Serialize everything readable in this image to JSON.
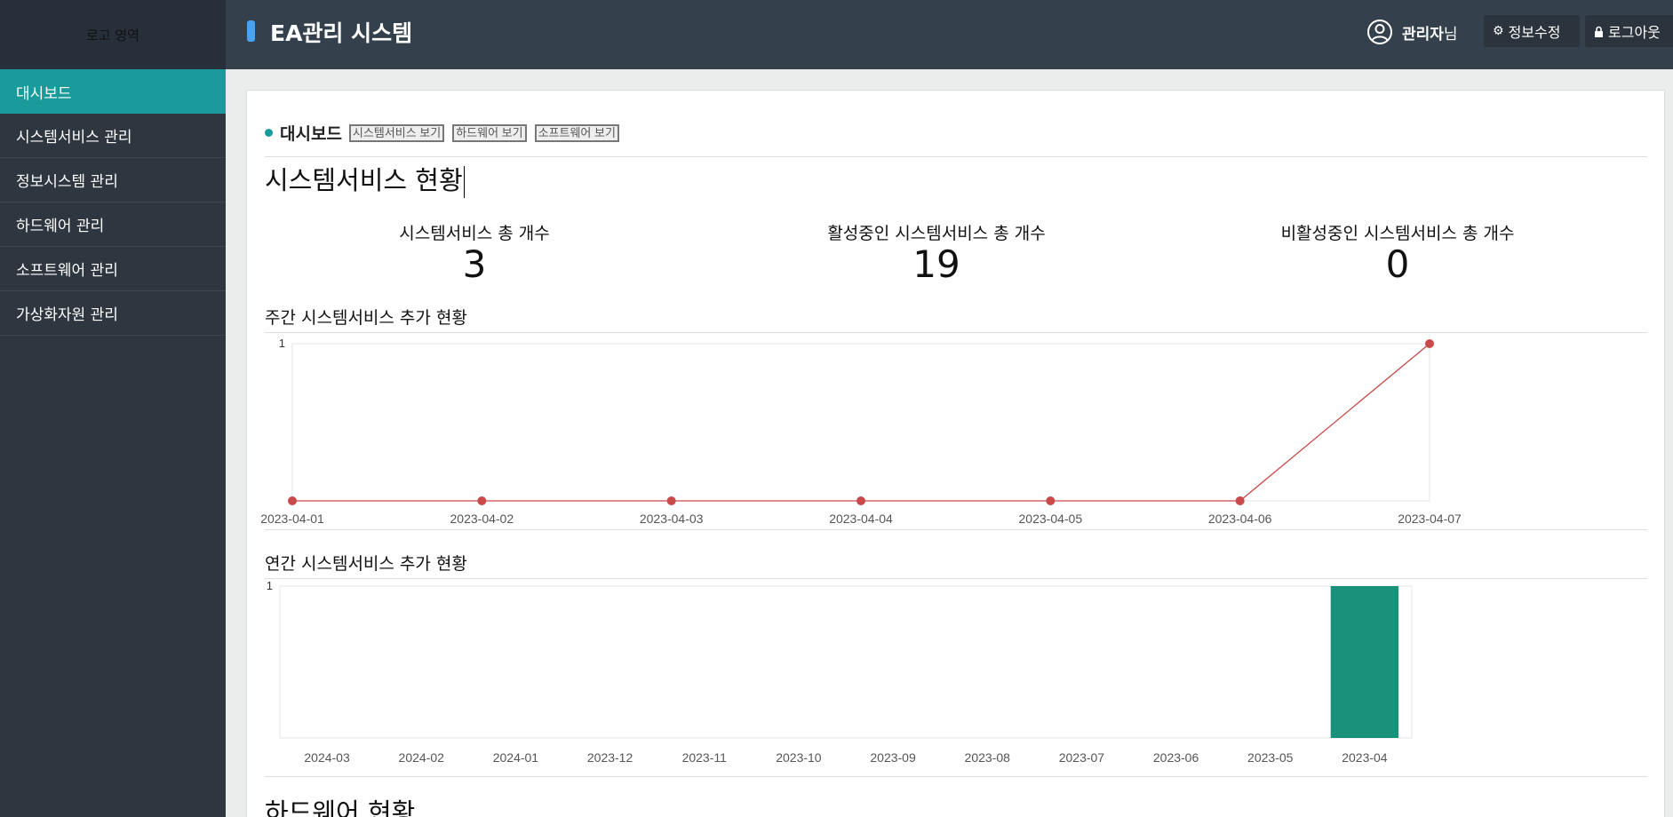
{
  "sidebar": {
    "logo": "로고 영역",
    "items": [
      {
        "label": "대시보드",
        "active": true
      },
      {
        "label": "시스템서비스 관리"
      },
      {
        "label": "정보시스템 관리"
      },
      {
        "label": "하드웨어 관리"
      },
      {
        "label": "소프트웨어 관리"
      },
      {
        "label": "가상화자원 관리"
      }
    ]
  },
  "header": {
    "title": "EA관리 시스템",
    "user_name": "관리자",
    "user_suffix": "님",
    "edit_label": "정보수정",
    "logout_label": "로그아웃",
    "icons": [
      "user-circle-icon",
      "gear-icon",
      "lock-icon"
    ],
    "accent": "#4aa3f0"
  },
  "main": {
    "breadcrumb_title": "대시보드",
    "view_buttons": [
      "시스템서비스 보기",
      "하드웨어 보기",
      "소프트웨어 보기"
    ],
    "section_title": "시스템서비스 현황",
    "stats": [
      {
        "label": "시스템서비스 총 개수",
        "value": "3"
      },
      {
        "label": "활성중인 시스템서비스 총 개수",
        "value": "19"
      },
      {
        "label": "비활성중인 시스템서비스 총 개수",
        "value": "0"
      }
    ],
    "weekly_chart_title": "주간 시스템서비스 추가 현황",
    "yearly_chart_title": "연간 시스템서비스 추가 현황",
    "next_section_title": "하드웨어 현황"
  },
  "colors": {
    "active": "#1a9a9a",
    "line": "#c94a4a",
    "bar": "#1a917a"
  },
  "chart_data": [
    {
      "type": "line",
      "title": "주간 시스템서비스 추가 현황",
      "x": [
        "2023-04-01",
        "2023-04-02",
        "2023-04-03",
        "2023-04-04",
        "2023-04-05",
        "2023-04-06",
        "2023-04-07"
      ],
      "values": [
        0,
        0,
        0,
        0,
        0,
        0,
        1
      ],
      "yticks": [
        "1"
      ],
      "ylim": [
        0,
        1
      ]
    },
    {
      "type": "bar",
      "title": "연간 시스템서비스 추가 현황",
      "categories": [
        "2024-03",
        "2024-02",
        "2024-01",
        "2023-12",
        "2023-11",
        "2023-10",
        "2023-09",
        "2023-08",
        "2023-07",
        "2023-06",
        "2023-05",
        "2023-04"
      ],
      "values": [
        0,
        0,
        0,
        0,
        0,
        0,
        0,
        0,
        0,
        0,
        0,
        1
      ],
      "yticks": [
        "1"
      ],
      "ylim": [
        0,
        1
      ]
    }
  ]
}
